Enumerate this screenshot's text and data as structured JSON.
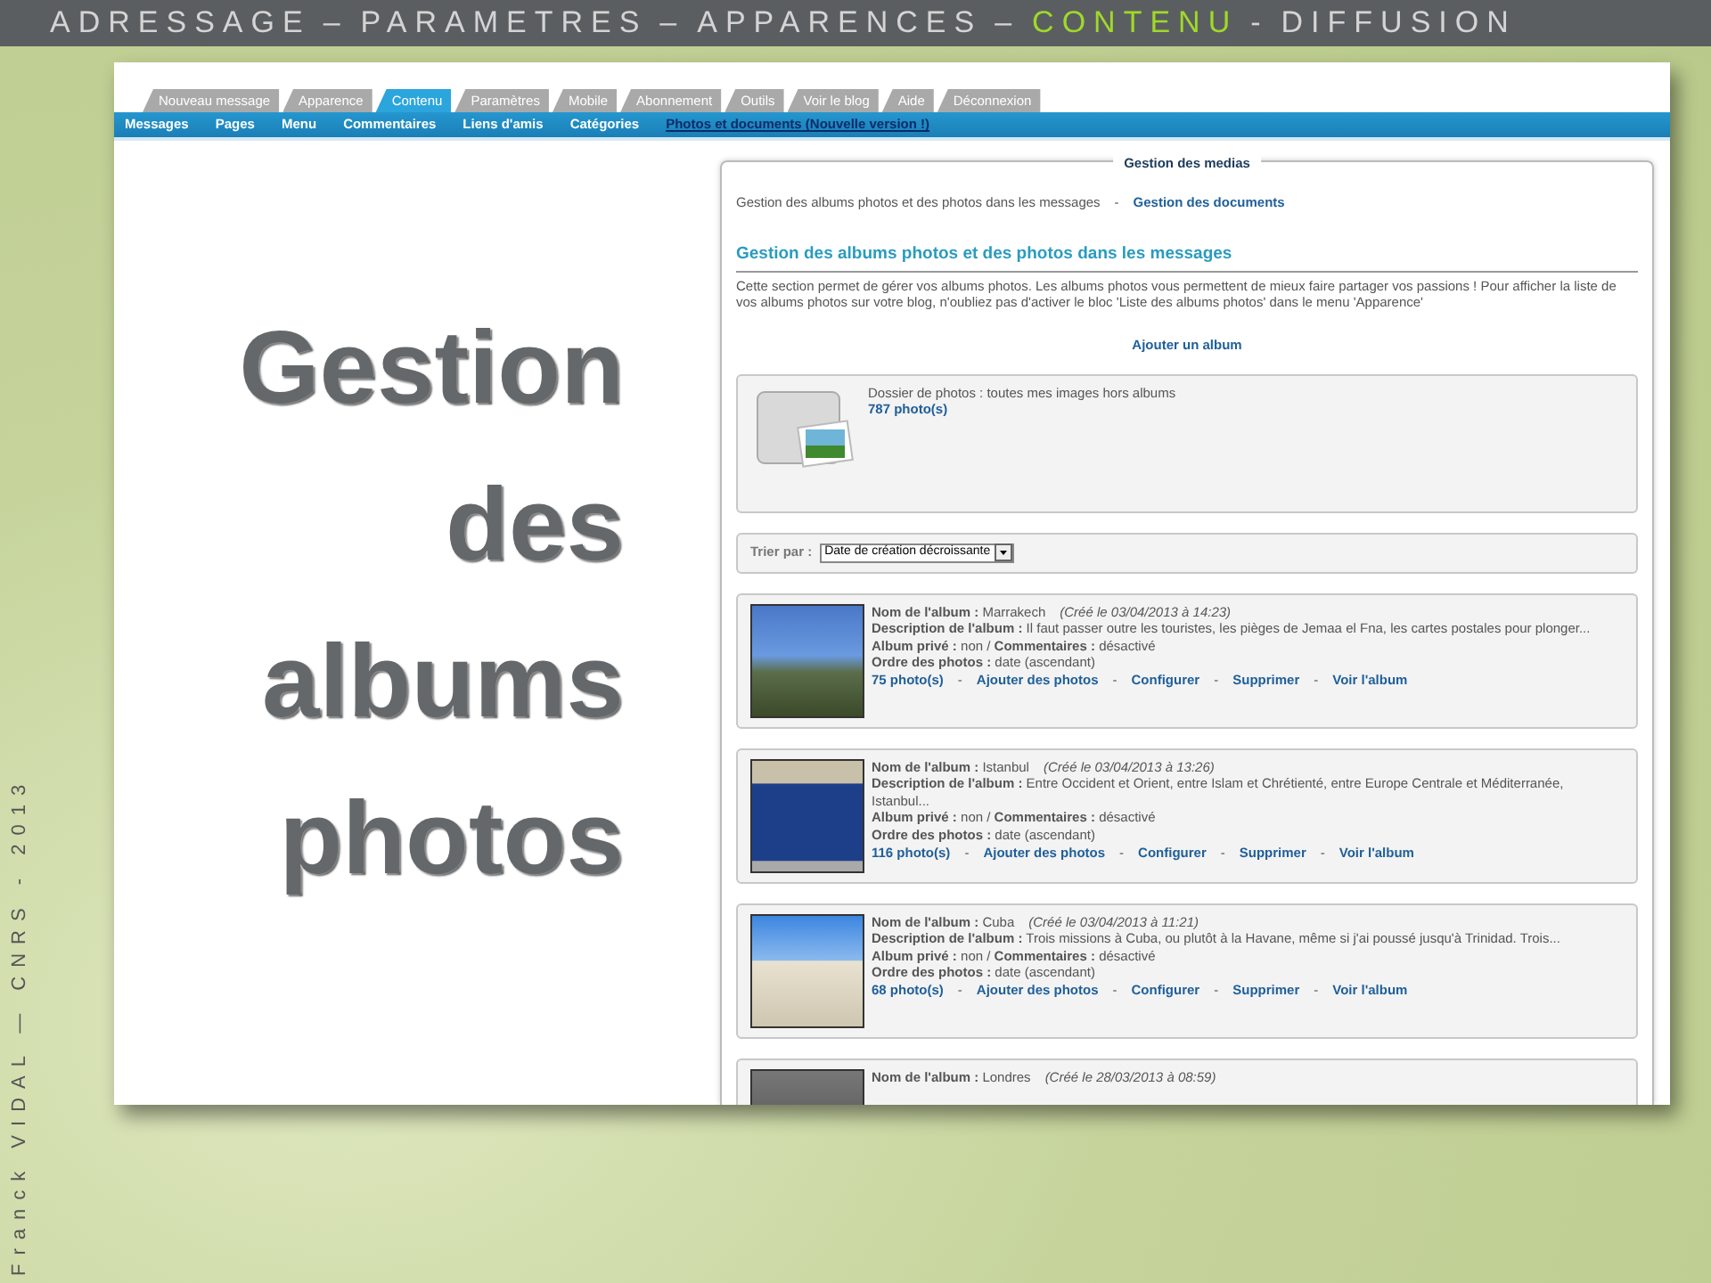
{
  "slide": {
    "breadcrumb": [
      {
        "kind": "step",
        "label": "ADRESSAGE",
        "selected": false
      },
      {
        "kind": "separator",
        "label": "–"
      },
      {
        "kind": "step",
        "label": "PARAMETRES",
        "selected": false
      },
      {
        "kind": "separator",
        "label": "–"
      },
      {
        "kind": "step",
        "label": "APPARENCES",
        "selected": false
      },
      {
        "kind": "separator",
        "label": "–"
      },
      {
        "kind": "step",
        "label": "CONTENU",
        "selected": true
      },
      {
        "kind": "separator",
        "label": "-"
      },
      {
        "kind": "step",
        "label": "DIFFUSION",
        "selected": false
      }
    ],
    "title": "Gestion des albums photos",
    "credit": "Franck VIDAL — CNRS - 2013"
  },
  "screenshot": {
    "tabs": [
      {
        "label": "Nouveau message",
        "selected": false
      },
      {
        "label": "Apparence",
        "selected": false
      },
      {
        "label": "Contenu",
        "selected": true
      },
      {
        "label": "Paramètres",
        "selected": false
      },
      {
        "label": "Mobile",
        "selected": false
      },
      {
        "label": "Abonnement",
        "selected": false
      },
      {
        "label": "Outils",
        "selected": false
      },
      {
        "label": "Voir le blog",
        "selected": false
      },
      {
        "label": "Aide",
        "selected": false
      },
      {
        "label": "Déconnexion",
        "selected": false
      }
    ],
    "menu": [
      {
        "label": "Messages",
        "selected": false
      },
      {
        "label": "Pages",
        "selected": false
      },
      {
        "label": "Menu",
        "selected": false
      },
      {
        "label": "Commentaires",
        "selected": false
      },
      {
        "label": "Liens d'amis",
        "selected": false
      },
      {
        "label": "Catégories",
        "selected": false
      },
      {
        "label": "Photos et documents (Nouvelle version !)",
        "selected": true
      }
    ],
    "panel": {
      "legend": "Gestion des medias",
      "sub_links": [
        {
          "kind": "link",
          "label": "Gestion des albums photos et des photos dans les messages",
          "selected": true
        },
        {
          "kind": "separator",
          "label": "-"
        },
        {
          "kind": "link",
          "label": "Gestion des documents",
          "selected": false
        }
      ],
      "heading": "Gestion des albums photos et des photos dans les messages",
      "intro": "Cette section permet de gérer vos albums photos. Les albums photos vous permettent de mieux faire partager vos passions ! Pour afficher la liste de vos albums photos sur votre blog, n'oubliez pas d'activer le bloc 'Liste des albums photos' dans le menu 'Apparence'",
      "add_album": "Ajouter un album",
      "folder": {
        "title": "Dossier de photos : toutes mes images hors albums",
        "count": "787 photo(s)"
      },
      "sort": {
        "label": "Trier par :",
        "value": "Date de création décroissante"
      },
      "albums": [
        {
          "name_line": "**Nom de l'album :** Marrakech",
          "created": "(Créé le 03/04/2013 à 14:23)",
          "description": "**Description de l'album :** Il faut passer outre les touristes, les pièges de Jemaa el Fna, les cartes postales pour plonger...",
          "privacy": "**Album privé :** non / **Commentaires :** désactivé",
          "order": "**Ordre des photos :** date (ascendant)",
          "actions": [
            {
              "kind": "link",
              "label": "75 photo(s)"
            },
            {
              "kind": "separator",
              "label": "-"
            },
            {
              "kind": "link",
              "label": "Ajouter des photos"
            },
            {
              "kind": "separator",
              "label": "-"
            },
            {
              "kind": "link",
              "label": "Configurer"
            },
            {
              "kind": "separator",
              "label": "-"
            },
            {
              "kind": "link",
              "label": "Supprimer"
            },
            {
              "kind": "separator",
              "label": "-"
            },
            {
              "kind": "link",
              "label": "Voir l'album"
            }
          ]
        },
        {
          "name_line": "**Nom de l'album :** Istanbul",
          "created": "(Créé le 03/04/2013 à 13:26)",
          "description": "**Description de l'album :** Entre Occident et Orient, entre Islam et Chrétienté, entre Europe Centrale et Méditerranée, Istanbul...",
          "privacy": "**Album privé :** non / **Commentaires :** désactivé",
          "order": "**Ordre des photos :** date (ascendant)",
          "actions": [
            {
              "kind": "link",
              "label": "116 photo(s)"
            },
            {
              "kind": "separator",
              "label": "-"
            },
            {
              "kind": "link",
              "label": "Ajouter des photos"
            },
            {
              "kind": "separator",
              "label": "-"
            },
            {
              "kind": "link",
              "label": "Configurer"
            },
            {
              "kind": "separator",
              "label": "-"
            },
            {
              "kind": "link",
              "label": "Supprimer"
            },
            {
              "kind": "separator",
              "label": "-"
            },
            {
              "kind": "link",
              "label": "Voir l'album"
            }
          ]
        },
        {
          "name_line": "**Nom de l'album :** Cuba",
          "created": "(Créé le 03/04/2013 à 11:21)",
          "description": "**Description de l'album :** Trois missions à Cuba, ou plutôt à la Havane, même si j'ai poussé jusqu'à Trinidad. Trois...",
          "privacy": "**Album privé :** non / **Commentaires :** désactivé",
          "order": "**Ordre des photos :** date (ascendant)",
          "actions": [
            {
              "kind": "link",
              "label": "68 photo(s)"
            },
            {
              "kind": "separator",
              "label": "-"
            },
            {
              "kind": "link",
              "label": "Ajouter des photos"
            },
            {
              "kind": "separator",
              "label": "-"
            },
            {
              "kind": "link",
              "label": "Configurer"
            },
            {
              "kind": "separator",
              "label": "-"
            },
            {
              "kind": "link",
              "label": "Supprimer"
            },
            {
              "kind": "separator",
              "label": "-"
            },
            {
              "kind": "link",
              "label": "Voir l'album"
            }
          ]
        },
        {
          "name_line": "**Nom de l'album :** Londres",
          "created": "(Créé le 28/03/2013 à 08:59)"
        }
      ]
    }
  }
}
